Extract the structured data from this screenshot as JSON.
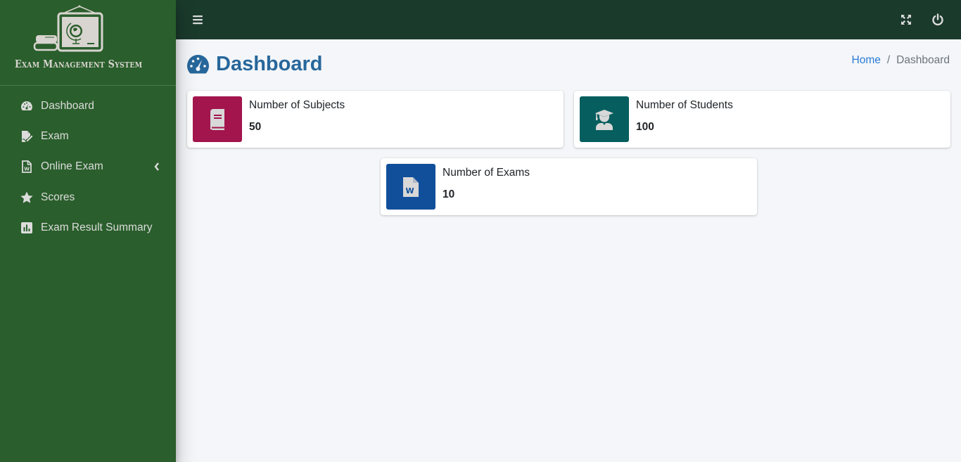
{
  "brand": {
    "name": "Exam Management System"
  },
  "sidebar": {
    "items": [
      {
        "label": "Dashboard",
        "icon": "tachometer-icon"
      },
      {
        "label": "Exam",
        "icon": "file-signature-icon"
      },
      {
        "label": "Online Exam",
        "icon": "file-word-icon",
        "has_submenu": true
      },
      {
        "label": "Scores",
        "icon": "star-icon"
      },
      {
        "label": "Exam Result Summary",
        "icon": "bar-chart-icon"
      }
    ]
  },
  "topbar": {
    "menu_icon": "hamburger-icon",
    "fullscreen_icon": "expand-icon",
    "logout_icon": "power-icon"
  },
  "header": {
    "title": "Dashboard",
    "breadcrumb": {
      "home": "Home",
      "separator": "/",
      "current": "Dashboard"
    }
  },
  "stats": [
    {
      "label": "Number of Subjects",
      "value": "50",
      "icon": "book-icon",
      "color": "#a3154d"
    },
    {
      "label": "Number of Students",
      "value": "100",
      "icon": "graduate-icon",
      "color": "#075e5f"
    },
    {
      "label": "Number of Exams",
      "value": "10",
      "icon": "file-word-icon",
      "color": "#114f9b"
    }
  ],
  "colors": {
    "sidebar_bg": "#2a5e2c",
    "topbar_bg": "#1a3a2c",
    "title_color": "#27679b",
    "link_color": "#2b7bd6"
  }
}
